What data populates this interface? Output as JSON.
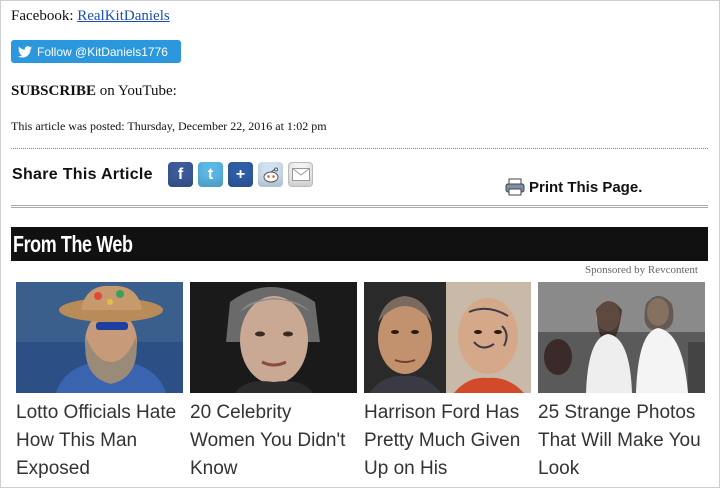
{
  "facebook": {
    "label": "Facebook:",
    "link": "RealKitDaniels"
  },
  "twitter_follow": {
    "label": "Follow @KitDaniels1776"
  },
  "subscribe": {
    "bold": "SUBSCRIBE",
    "rest": "on YouTube:"
  },
  "posted": "This article was posted: Thursday, December 22, 2016 at 1:02 pm",
  "share": {
    "label": "Share This Article",
    "icons": [
      "facebook-icon",
      "twitter-icon",
      "delicious-icon",
      "reddit-icon",
      "email-icon"
    ]
  },
  "print": {
    "label": "Print This Page."
  },
  "from_web": {
    "title": "From The Web",
    "sponsored": "Sponsored by Revcontent"
  },
  "cards": [
    {
      "title": "Lotto Officials Hate How This Man Exposed"
    },
    {
      "title": "20 Celebrity Women You Didn't Know"
    },
    {
      "title": "Harrison Ford Has Pretty Much Given Up on His"
    },
    {
      "title": "25 Strange Photos That Will Make You Look"
    }
  ],
  "colors": {
    "link": "#1a4fb8",
    "twitter_blue": "#2b97dc",
    "bar_black": "#111111"
  }
}
